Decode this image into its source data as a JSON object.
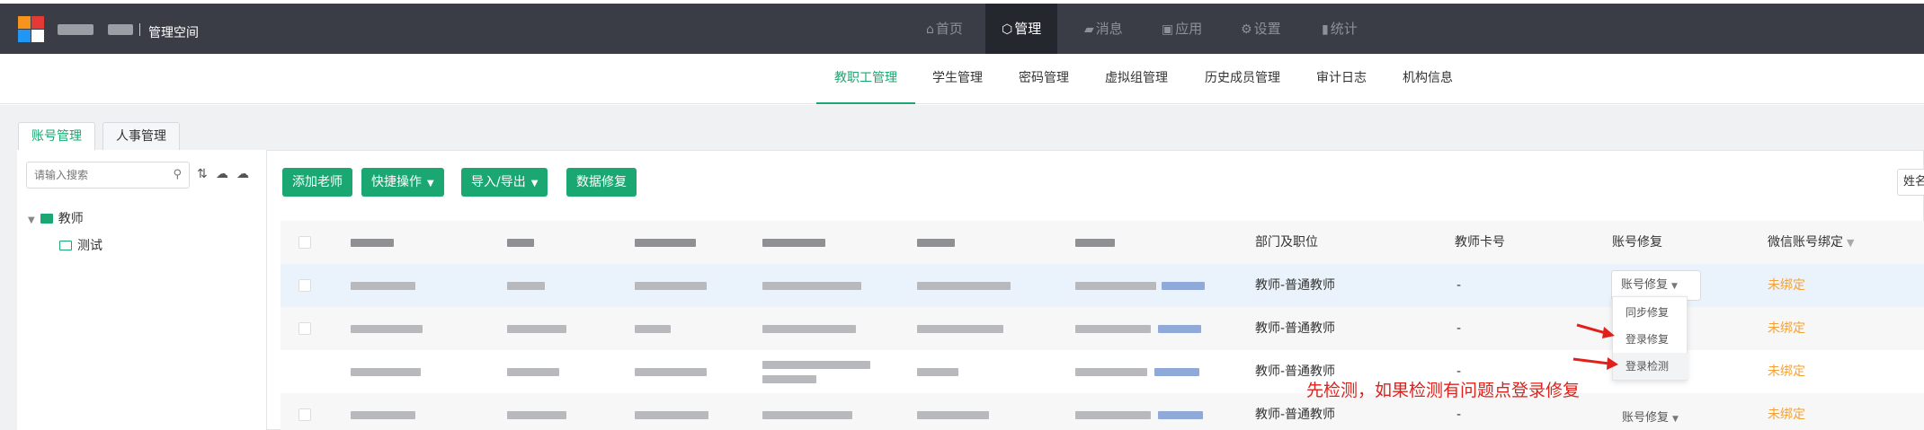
{
  "header": {
    "org_title": "管理空间",
    "nav": [
      {
        "icon": "home-icon",
        "glyph": "⌂",
        "label": "首页"
      },
      {
        "icon": "cube-icon",
        "glyph": "⬡",
        "label": "管理"
      },
      {
        "icon": "message-icon",
        "glyph": "▰",
        "label": "消息"
      },
      {
        "icon": "app-icon",
        "glyph": "▣",
        "label": "应用"
      },
      {
        "icon": "gear-icon",
        "glyph": "⚙",
        "label": "设置"
      },
      {
        "icon": "stats-icon",
        "glyph": "▮",
        "label": "统计"
      }
    ],
    "active_nav": "管理"
  },
  "subnav": {
    "tabs": [
      "教职工管理",
      "学生管理",
      "密码管理",
      "虚拟组管理",
      "历史成员管理",
      "审计日志",
      "机构信息"
    ],
    "active": "教职工管理"
  },
  "account_tabs": {
    "tabs": [
      "账号管理",
      "人事管理"
    ],
    "active": "账号管理"
  },
  "sidebar": {
    "search_placeholder": "请输入搜索",
    "tree": {
      "root": "教师",
      "children": [
        "测试"
      ]
    }
  },
  "toolbar": {
    "add_teacher": "添加老师",
    "quick_ops": "快捷操作",
    "import_export": "导入/导出",
    "data_repair": "数据修复",
    "name_filter": "姓名"
  },
  "table": {
    "headers": {
      "dept": "部门及职位",
      "card": "教师卡号",
      "repair": "账号修复",
      "wechat": "微信账号绑定"
    },
    "rows": [
      {
        "dept": "教师-普通教师",
        "card": "-",
        "repair": "账号修复",
        "wechat": "未绑定"
      },
      {
        "dept": "教师-普通教师",
        "card": "-",
        "repair": "",
        "wechat": "未绑定"
      },
      {
        "dept": "教师-普通教师",
        "card": "-",
        "repair": "",
        "wechat": "未绑定"
      },
      {
        "dept": "教师-普通教师",
        "card": "-",
        "repair": "账号修复",
        "wechat": "未绑定"
      }
    ]
  },
  "dropdown": {
    "items": [
      "同步修复",
      "登录修复",
      "登录检测"
    ],
    "highlighted": "登录检测"
  },
  "annotation": "先检测，如果检测有问题点登录修复",
  "colors": {
    "brand_green": "#1aa772",
    "topbar": "#3b3d46",
    "pending_orange": "#f2a23a",
    "annotation_red": "#e0201a"
  }
}
